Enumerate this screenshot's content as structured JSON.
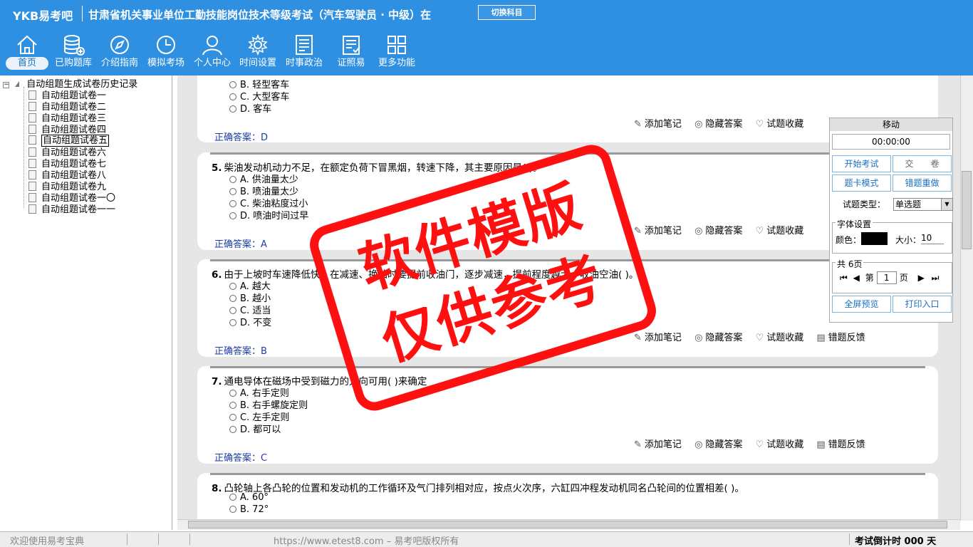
{
  "header": {
    "logo": "YKB易考吧",
    "title": "甘肃省机关事业单位工勤技能岗位技术等级考试（汽车驾驶员 · 中级）在",
    "switch_label": "切换科目"
  },
  "nav": [
    {
      "label": "首页",
      "icon": "home-icon"
    },
    {
      "label": "已购题库",
      "icon": "database-icon"
    },
    {
      "label": "介绍指南",
      "icon": "compass-icon"
    },
    {
      "label": "模拟考场",
      "icon": "clock-icon"
    },
    {
      "label": "个人中心",
      "icon": "user-icon"
    },
    {
      "label": "时间设置",
      "icon": "gear-icon"
    },
    {
      "label": "时事政治",
      "icon": "news-icon"
    },
    {
      "label": "证照易",
      "icon": "certificate-icon"
    },
    {
      "label": "更多功能",
      "icon": "grid-icon"
    }
  ],
  "tree": {
    "root": "自动组题生成试卷历史记录",
    "items": [
      "自动组题试卷一",
      "自动组题试卷二",
      "自动组题试卷三",
      "自动组题试卷四",
      "自动组题试卷五",
      "自动组题试卷六",
      "自动组题试卷七",
      "自动组题试卷八",
      "自动组题试卷九",
      "自动组题试卷一〇",
      "自动组题试卷一一"
    ],
    "selected_index": 4
  },
  "tools": {
    "note": "添加笔记",
    "hide": "隐藏答案",
    "fav": "试题收藏",
    "feedback": "错题反馈"
  },
  "questions": [
    {
      "num": "",
      "text": "",
      "options": [
        "B. 轻型客车",
        "C. 大型客车",
        "D. 客车"
      ],
      "answer": "正确答案：D"
    },
    {
      "num": "5.",
      "text": "柴油发动机动力不足，在额定负荷下冒黑烟，转速下降，其主要原因是( )。",
      "options": [
        "A. 供油量太少",
        "B. 喷油量太少",
        "C. 柴油粘度过小",
        "D. 喷油时间过早"
      ],
      "answer": "正确答案：A"
    },
    {
      "num": "6.",
      "text": "由于上坡时车速降低快，在减速、换挡时要提前收油门，逐步减速，提前程度越大，收油空油( )。",
      "options": [
        "A. 越大",
        "B. 越小",
        "C. 适当",
        "D. 不变"
      ],
      "answer": "正确答案：B"
    },
    {
      "num": "7.",
      "text": "通电导体在磁场中受到磁力的方向可用( )来确定",
      "options": [
        "A. 右手定则",
        "B. 右手螺旋定则",
        "C. 左手定则",
        "D. 都可以"
      ],
      "answer": "正确答案：C"
    },
    {
      "num": "8.",
      "text": "凸轮轴上各凸轮的位置和发动机的工作循环及气门排列相对应，按点火次序，六缸四冲程发动机同名凸轮间的位置相差( )。",
      "options": [
        "A. 60°",
        "B. 72°"
      ],
      "answer": ""
    }
  ],
  "panel": {
    "title": "移动",
    "timer": "00:00:00",
    "start": "开始考试",
    "submit": "交　　卷",
    "card_mode": "题卡模式",
    "redo": "错题重做",
    "qtype_label": "试题类型：",
    "qtype_value": "单选题",
    "font_title": "字体设置",
    "color_label": "颜色：",
    "size_label": "大小：",
    "size_value": "10",
    "pages_title": "共 6页",
    "page_prefix": "第",
    "page_value": "1",
    "page_suffix": "页",
    "preview": "全屏预览",
    "print": "打印入口"
  },
  "stamp": {
    "line1": "软件模版",
    "line2": "仅供参考"
  },
  "status": {
    "welcome": "欢迎使用易考宝典",
    "url": "https://www.etest8.com – 易考吧版权所有",
    "countdown": "考试倒计时 000 天"
  }
}
